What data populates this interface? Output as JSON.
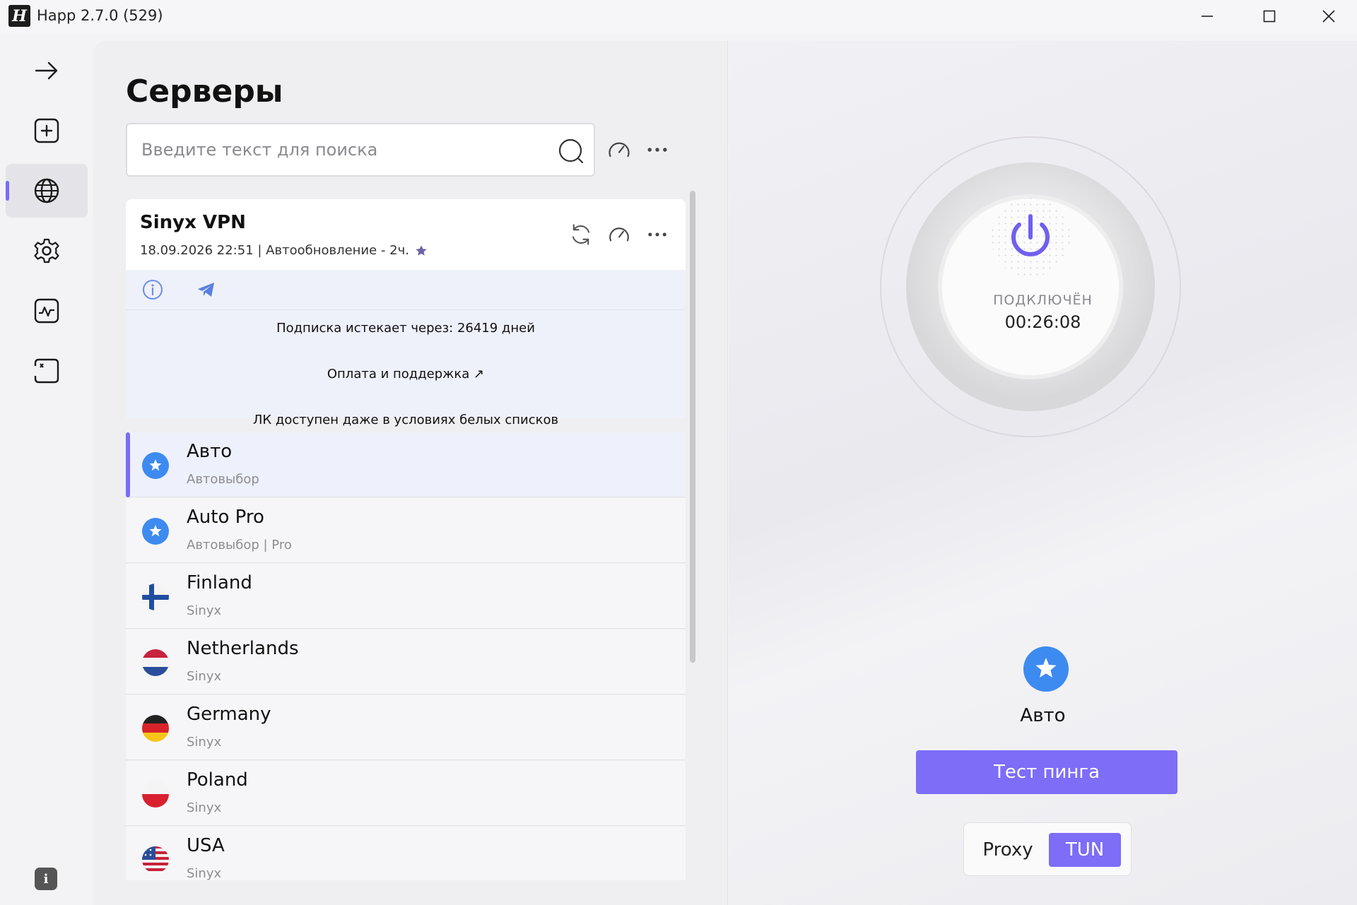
{
  "window": {
    "logo_letter": "H",
    "title": "Happ 2.7.0 (529)"
  },
  "sidebar": {
    "items": [
      {
        "icon": "arrow-right-icon",
        "active": false
      },
      {
        "icon": "add-square-icon",
        "active": false
      },
      {
        "icon": "globe-icon",
        "active": true
      },
      {
        "icon": "gear-icon",
        "active": false
      },
      {
        "icon": "activity-chart-icon",
        "active": false
      },
      {
        "icon": "code-frame-icon",
        "active": false
      }
    ],
    "info_label": "i"
  },
  "servers": {
    "title": "Серверы",
    "search_placeholder": "Введите текст для поиска",
    "subscription": {
      "name": "Sinyx VPN",
      "meta": "18.09.2026 22:51 | Автообновление - 2ч.",
      "expires": "Подписка истекает через: 26419 дней",
      "support_link": "Оплата и поддержка ↗",
      "note": "ЛК доступен даже в условиях белых списков"
    },
    "items": [
      {
        "name": "Авто",
        "subtitle": "Автовыбор",
        "icon": "star-circle-icon",
        "selected": true
      },
      {
        "name": "Auto Pro",
        "subtitle": "Автовыбор | Pro",
        "icon": "star-circle-icon",
        "selected": false
      },
      {
        "name": "Finland",
        "subtitle": "Sinyx",
        "icon": "flag-finland-icon",
        "selected": false
      },
      {
        "name": "Netherlands",
        "subtitle": "Sinyx",
        "icon": "flag-netherlands-icon",
        "selected": false
      },
      {
        "name": "Germany",
        "subtitle": "Sinyx",
        "icon": "flag-germany-icon",
        "selected": false
      },
      {
        "name": "Poland",
        "subtitle": "Sinyx",
        "icon": "flag-poland-icon",
        "selected": false
      },
      {
        "name": "USA",
        "subtitle": "Sinyx",
        "icon": "flag-usa-icon",
        "selected": false
      }
    ]
  },
  "connection": {
    "status": "ПОДКЛЮЧЁН",
    "timer": "00:26:08",
    "selected_server": "Авто",
    "ping_button": "Тест пинга",
    "modes": [
      "Proxy",
      "TUN"
    ],
    "active_mode": "TUN"
  },
  "colors": {
    "accent": "#7d6df7",
    "star_blue": "#3d8bf0"
  }
}
